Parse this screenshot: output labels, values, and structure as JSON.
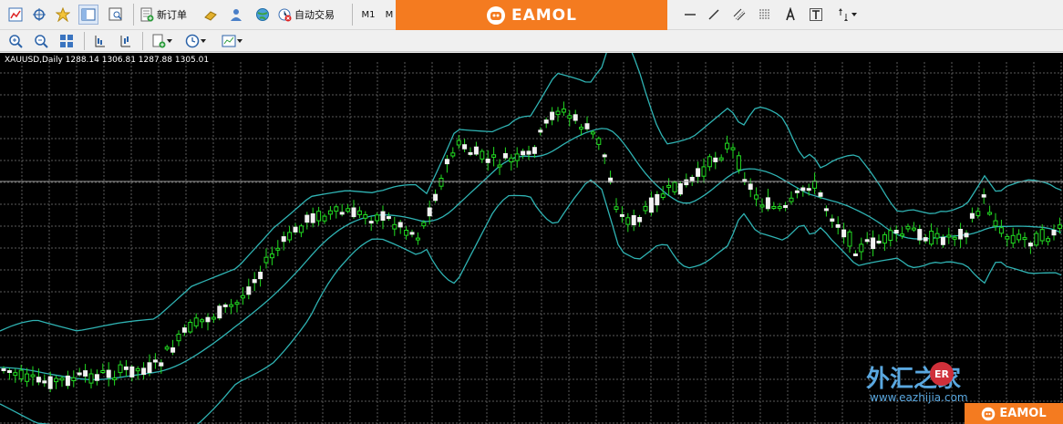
{
  "toolbar1": {
    "new_order_label": "新订单",
    "auto_trade_label": "自动交易",
    "timeframe_m1": "M1",
    "timeframe_m_partial": "M"
  },
  "banner": {
    "brand": "EAMOL",
    "color": "#f47b20"
  },
  "chart": {
    "info_line": "XAUUSD,Daily  1288.14 1306.81 1287.88 1305.01",
    "background": "#000000",
    "grid_color": "#5a5a5a",
    "candle_color": "#22dd22",
    "band_color": "#2fb3b3"
  },
  "watermark": {
    "site_name": "外汇之家",
    "badge": "ER",
    "url": "www.eazhijia.com",
    "brand": "EAMOL"
  }
}
